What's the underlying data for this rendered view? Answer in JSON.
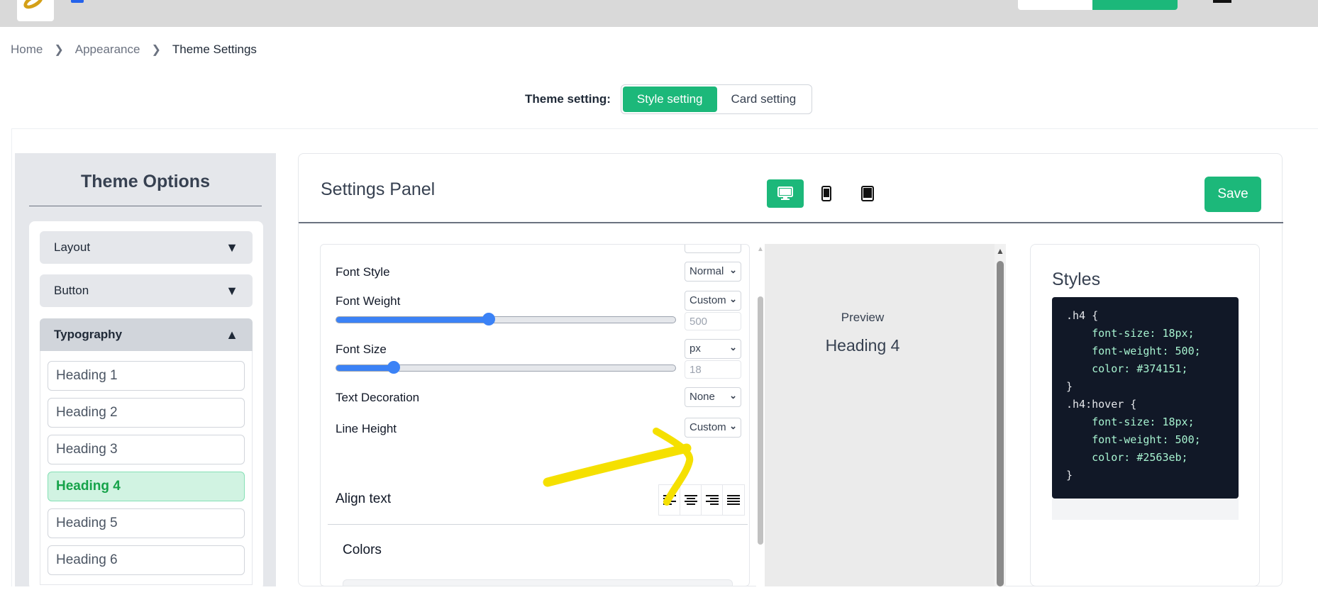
{
  "breadcrumb": {
    "home": "Home",
    "appearance": "Appearance",
    "current": "Theme Settings"
  },
  "theme_setting": {
    "label": "Theme setting:",
    "options": [
      "Style setting",
      "Card setting"
    ],
    "active": "Style setting"
  },
  "sidebar": {
    "title": "Theme Options",
    "sections": [
      {
        "label": "Layout",
        "state": "collapsed"
      },
      {
        "label": "Button",
        "state": "collapsed"
      },
      {
        "label": "Typography",
        "state": "expanded"
      }
    ],
    "typography_items": [
      "Heading 1",
      "Heading 2",
      "Heading 3",
      "Heading 4",
      "Heading 5",
      "Heading 6"
    ],
    "active_item": "Heading 4"
  },
  "panel": {
    "title": "Settings Panel",
    "devices": [
      "desktop-icon",
      "mobile-icon",
      "tablet-icon"
    ],
    "active_device": "desktop-icon",
    "save_label": "Save"
  },
  "settings": {
    "font_style": {
      "label": "Font Style",
      "value": "Normal"
    },
    "font_weight": {
      "label": "Font Weight",
      "mode": "Custom",
      "value": "500",
      "slider_fraction": 0.45
    },
    "font_size": {
      "label": "Font Size",
      "unit": "px",
      "value": "18",
      "slider_fraction": 0.17
    },
    "text_decoration": {
      "label": "Text Decoration",
      "value": "None"
    },
    "line_height": {
      "label": "Line Height",
      "value": "Custom"
    },
    "align_text": {
      "label": "Align text",
      "options": [
        "align-left-icon",
        "align-center-icon",
        "align-right-icon",
        "align-justify-icon"
      ]
    },
    "colors_title": "Colors"
  },
  "preview": {
    "label": "Preview",
    "heading": "Heading 4"
  },
  "styles": {
    "title": "Styles",
    "code": [
      {
        "sel": ".h4 {",
        "props": [
          "font-size: 18px;",
          "font-weight: 500;",
          "color: #374151;"
        ]
      },
      {
        "sel": ".h4:hover {",
        "props": [
          "font-size: 18px;",
          "font-weight: 500;",
          "color: #2563eb;"
        ]
      }
    ]
  },
  "colors": {
    "accent": "#1cb87a",
    "slider": "#3b82f6",
    "annotation": "#f5e000"
  }
}
